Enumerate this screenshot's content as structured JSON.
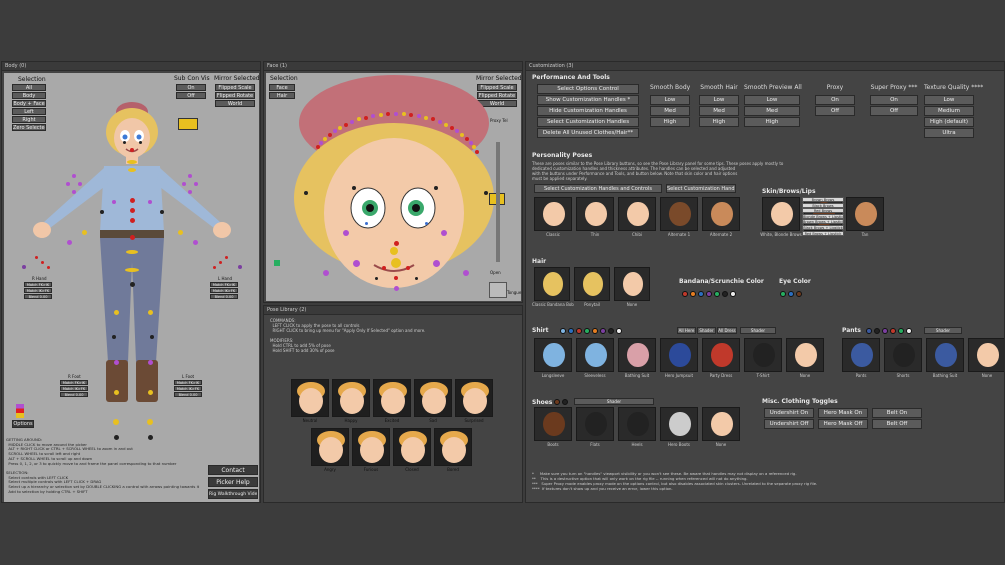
{
  "body_panel": {
    "title": "Body (0)",
    "selection_header": "Selection",
    "selection_buttons": [
      "All",
      "Body",
      "Body + Face",
      "Left",
      "Right",
      "Zero Selected"
    ],
    "sub_con_vis_header": "Sub Con Vis",
    "sub_con_vis_buttons": [
      "On",
      "Off"
    ],
    "mirror_selected_header": "Mirror Selected",
    "mirror_buttons": [
      "Flipped Scale",
      "Flipped Rotate",
      "World"
    ],
    "r_hand": {
      "label": "R Hand",
      "rows": [
        "Match FK>IK",
        "Match IK>FK",
        "Blend  0.00"
      ]
    },
    "l_hand": {
      "label": "L Hand",
      "rows": [
        "Match FK>IK",
        "Match IK>FK",
        "Blend  0.00"
      ]
    },
    "r_foot": {
      "label": "R Foot",
      "rows": [
        "Match FK>IK",
        "Match IK>FK",
        "Blend  0.00"
      ]
    },
    "l_foot": {
      "label": "L Foot",
      "rows": [
        "Match FK>IK",
        "Match IK>FK",
        "Blend  0.00"
      ]
    },
    "options_label": "Options",
    "instructions": "GETTING AROUND:\n  MIDDLE CLICK to move around the picker\n  ALT + RIGHT CLICK or CTRL + SCROLL WHEEL to zoom in and out\n  SCROLL WHEEL to scroll left and right\n  ALT + SCROLL WHEEL to scroll up and down\n  Press 0, 1, 2, or 3 to quickly move to and frame the panel corresponding to that number\n\nSELECTION:\n  Select controls with LEFT CLICK\n  Select multiple controls with LEFT CLICK + DRAG\n  Select up a hierarchy or selection set by DOUBLE CLICKING a control with arrows pointing towards it\n  Add to selection by holding CTRL + SHIFT",
    "contact_label": "Contact",
    "picker_help_label": "Picker Help",
    "walkthrough_label": "Rig Walkthrough Video"
  },
  "face_panel": {
    "title": "Face (1)",
    "selection_header": "Selection",
    "selection_buttons": [
      "Face",
      "Hair"
    ],
    "mirror_selected_header": "Mirror Selected",
    "mirror_buttons": [
      "Flipped Scale",
      "Flipped Rotate",
      "World"
    ],
    "proxy_label": "Proxy Tel",
    "jaw_label": "Open",
    "tongue_label": "Tongue"
  },
  "pose_panel": {
    "title": "Pose Library (2)",
    "instructions": "COMMANDS:\n  LEFT CLICK to apply the pose to all controls\n  RIGHT CLICK to bring up menu for \"Apply Only If Selected\" option and more.\n\nMODIFIERS:\n  Hold CTRL to add 5% of pose\n  Hold SHIFT to add 30% of pose",
    "poses_row1": [
      "Neutral",
      "Happy",
      "Excited",
      "Sad",
      "Surprised"
    ],
    "poses_row2": [
      "Angry",
      "Furious",
      "Closed",
      "Bored"
    ]
  },
  "custom_panel": {
    "title": "Customization (3)",
    "perf_header": "Performance And Tools",
    "perf_buttons": [
      "Select Options Control",
      "Show Customization Handles *",
      "Hide Customization Handles",
      "Select Customization Handles",
      "Delete All Unused Clothes/Hair**"
    ],
    "smooth_body": {
      "label": "Smooth Body",
      "options": [
        "Low",
        "Med",
        "High"
      ]
    },
    "smooth_hair": {
      "label": "Smooth Hair",
      "options": [
        "Low",
        "Med",
        "High"
      ]
    },
    "smooth_preview": {
      "label": "Smooth Preview All",
      "options": [
        "Low",
        "Med",
        "High"
      ]
    },
    "proxy": {
      "label": "Proxy",
      "options": [
        "On",
        "Off"
      ]
    },
    "super_proxy": {
      "label": "Super Proxy ***",
      "options": [
        "On",
        "Off"
      ]
    },
    "texture_quality": {
      "label": "Texture Quality ****",
      "options": [
        "Low",
        "Medium",
        "High (default)",
        "Ultra"
      ]
    },
    "personality_header": "Personality Poses",
    "personality_text": "These are poses similar to the Pose Library buttons, so see the Pose Library panel for some tips. These poses apply mostly to\ndedicated customization handles and thickness attributes. The handles can be selected and adjusted\nwith the buttons under Performance and Tools, and button below. Note that skin color and hair options\nmust be applied separately.",
    "select_handles_controls": "Select Customization Handles and Controls",
    "select_handles": "Select Customization Handles",
    "personalities": [
      "Classic",
      "Thin",
      "Chibi",
      "Alternate 1",
      "Alternate 2"
    ],
    "skin_header": "Skin/Brows/Lips",
    "skin_menu": [
      "Brown Brows",
      "Black Brows",
      "Red Brows",
      "Blonde Brows + Lipstick",
      "Brown Brows + Lipstick",
      "Black Brows + Lipstick",
      "Red Brows + Lipstick"
    ],
    "skins": [
      "White, Blonde Brows",
      "Black",
      "Tan"
    ],
    "hair_header": "Hair",
    "hairs": [
      "Classic Bandana Bob",
      "Ponytail",
      "None"
    ],
    "bandana_header": "Bandana/Scrunchie Color",
    "eye_header": "Eye Color",
    "shirt_header": "Shirt",
    "shirt_buttons": [
      "All Here",
      "Shader",
      "All Dress",
      "Shader"
    ],
    "shirts": [
      "Longsleeve",
      "Sleeveless",
      "Bathing Suit",
      "Hero Jumpsuit",
      "Party Dress",
      "T-Shirt",
      "None"
    ],
    "pants_header": "Pants",
    "pants_shader": "Shader",
    "pants": [
      "Pants",
      "Shorts",
      "Bathing Suit",
      "None"
    ],
    "shoes_header": "Shoes",
    "shoes_shader": "Shader",
    "shoes": [
      "Boots",
      "Flats",
      "Heels",
      "Hero Boots",
      "None"
    ],
    "misc_header": "Misc. Clothing Toggles",
    "misc_buttons": [
      "Undershirt On",
      "Hero Mask On",
      "Belt On",
      "Undershirt Off",
      "Hero Mask Off",
      "Belt Off"
    ],
    "footnotes": "*     Make sure you turn on \"handles\" viewport visibility or you won't see these. Be aware that handles may not display on a referenced rig.\n**    This is a destructive option that will only work on the rig file -- running when referenced will not do anything.\n***   Super Proxy mode enables proxy mode on the options control, but also disables associated skin clusters. Unrelated to the separate proxy rig file.\n****  If textures don't show up and you receive an error, lower this option."
  },
  "colors": {
    "bandana": [
      "#c0392b",
      "#e67e22",
      "#2c6fbf",
      "#7b3fa0",
      "#27ae60",
      "#222222",
      "#eeeeee"
    ],
    "eye": [
      "#27ae60",
      "#2c6fbf",
      "#6b3a1e"
    ],
    "shirt": [
      "#7fb3e0",
      "#2c6fbf",
      "#c0392b",
      "#27ae60",
      "#e67e22",
      "#7b3fa0",
      "#222222",
      "#eeeeee"
    ],
    "pants": [
      "#3b5aa0",
      "#222222",
      "#7b3fa0",
      "#c0392b",
      "#27ae60",
      "#eeeeee"
    ],
    "shoes": [
      "#6b3a1e",
      "#222222"
    ]
  }
}
